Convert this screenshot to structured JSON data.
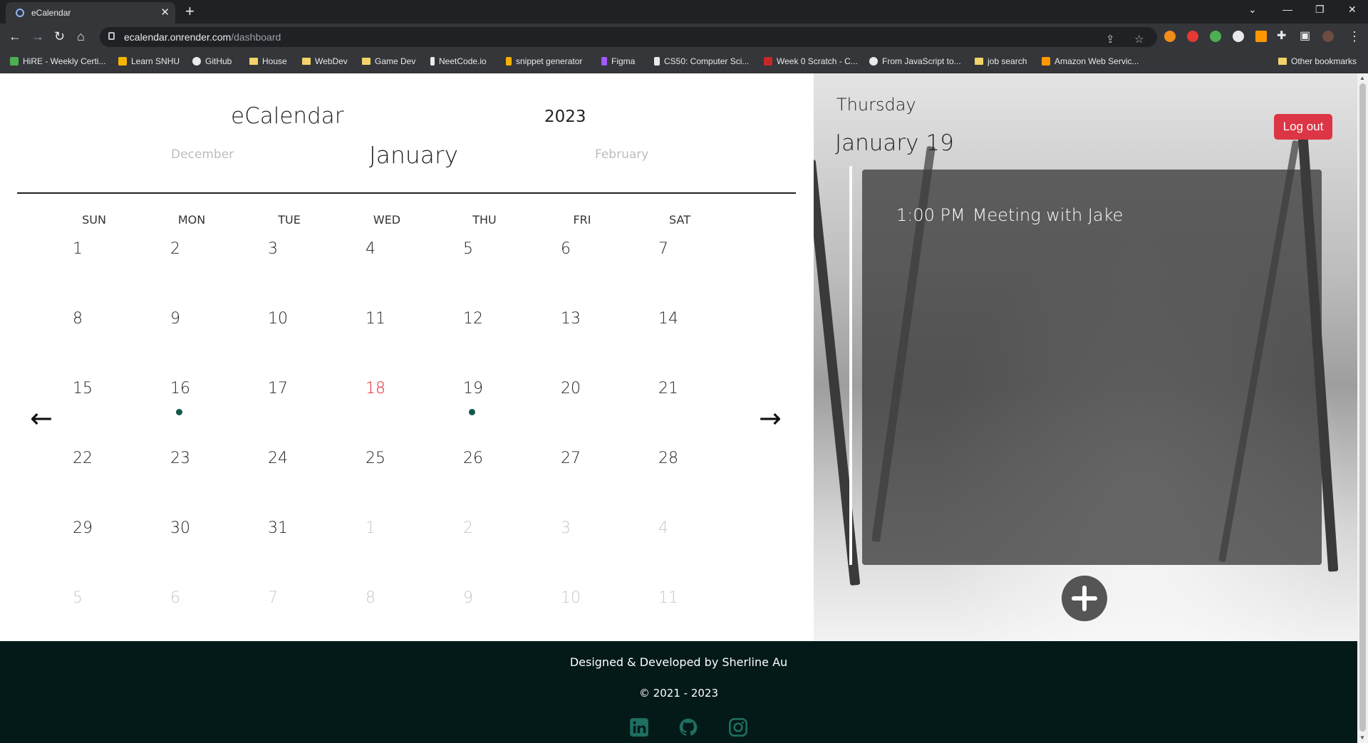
{
  "browser": {
    "tab_title": "eCalendar",
    "url_host": "ecalendar.onrender.com",
    "url_path": "/dashboard",
    "bookmarks": [
      "HiRE - Weekly Certi...",
      "Learn SNHU",
      "GitHub",
      "House",
      "WebDev",
      "Game Dev",
      "NeetCode.io",
      "snippet generator",
      "Figma",
      "CS50: Computer Sci...",
      "Week 0 Scratch - C...",
      "From JavaScript to...",
      "job search",
      "Amazon Web Servic..."
    ],
    "other_bookmarks": "Other bookmarks"
  },
  "calendar": {
    "title": "eCalendar",
    "year": "2023",
    "prev_month": "December",
    "current_month": "January",
    "next_month": "February",
    "weekdays": [
      "SUN",
      "MON",
      "TUE",
      "WED",
      "THU",
      "FRI",
      "SAT"
    ],
    "weeks": [
      [
        "1",
        "2",
        "3",
        "4",
        "5",
        "6",
        "7"
      ],
      [
        "8",
        "9",
        "10",
        "11",
        "12",
        "13",
        "14"
      ],
      [
        "15",
        "16",
        "17",
        "18",
        "19",
        "20",
        "21"
      ],
      [
        "22",
        "23",
        "24",
        "25",
        "26",
        "27",
        "28"
      ],
      [
        "29",
        "30",
        "31",
        "1",
        "2",
        "3",
        "4"
      ],
      [
        "5",
        "6",
        "7",
        "8",
        "9",
        "10",
        "11"
      ]
    ],
    "today": "18",
    "days_with_events": [
      "16",
      "19"
    ],
    "prev_arrow": "←",
    "next_arrow": "→",
    "event_dot_color": "#13584d",
    "today_color": "#e0262f"
  },
  "panel": {
    "weekday": "Thursday",
    "date": "January 19",
    "logout_label": "Log out",
    "events": [
      {
        "time": "1:00 PM",
        "title": "Meeting with Jake"
      }
    ],
    "add_icon": "plus-circle-icon"
  },
  "footer": {
    "credit": "Designed & Developed by Sherline Au",
    "copyright": "© 2021 - 2023",
    "social_icons": [
      "linkedin-icon",
      "github-icon",
      "instagram-icon"
    ],
    "social_color": "#1f6e62"
  }
}
